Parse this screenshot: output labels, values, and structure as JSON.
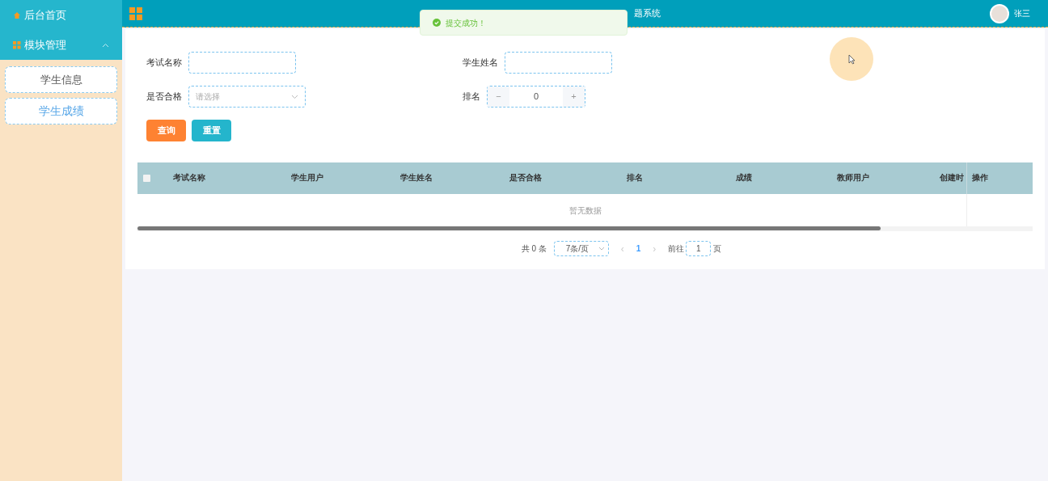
{
  "sidebar": {
    "items": [
      {
        "label": "后台首页",
        "kind": "link"
      },
      {
        "label": "模块管理",
        "kind": "group",
        "expanded": true,
        "children": [
          {
            "label": "学生信息",
            "selected": false
          },
          {
            "label": "学生成绩",
            "selected": true
          }
        ]
      }
    ]
  },
  "header": {
    "title": "题系统",
    "user": "张三"
  },
  "toast": {
    "message": "提交成功！"
  },
  "filters": [
    {
      "label": "考试名称",
      "kind": "text"
    },
    {
      "label": "学生姓名",
      "kind": "text"
    },
    {
      "label": "是否合格",
      "kind": "select",
      "placeholder": "请选择"
    },
    {
      "label": "排名",
      "kind": "number",
      "value": "0",
      "minus": "−",
      "plus": "+"
    }
  ],
  "buttons": [
    {
      "label": "查询",
      "kind": "primary"
    },
    {
      "label": "重置",
      "kind": "secondary"
    }
  ],
  "table": {
    "columns": [
      "考试名称",
      "学生用户",
      "学生姓名",
      "是否合格",
      "排名",
      "成绩",
      "教师用户",
      "创建时",
      "操作"
    ],
    "select_all": false,
    "empty": "暂无数据"
  },
  "pagination": {
    "total": "共 0 条",
    "page_size": "7条/页",
    "prev": "‹",
    "page": "1",
    "next": "›",
    "goto": "前往",
    "goto_value": "1",
    "page_suffix": "页"
  }
}
